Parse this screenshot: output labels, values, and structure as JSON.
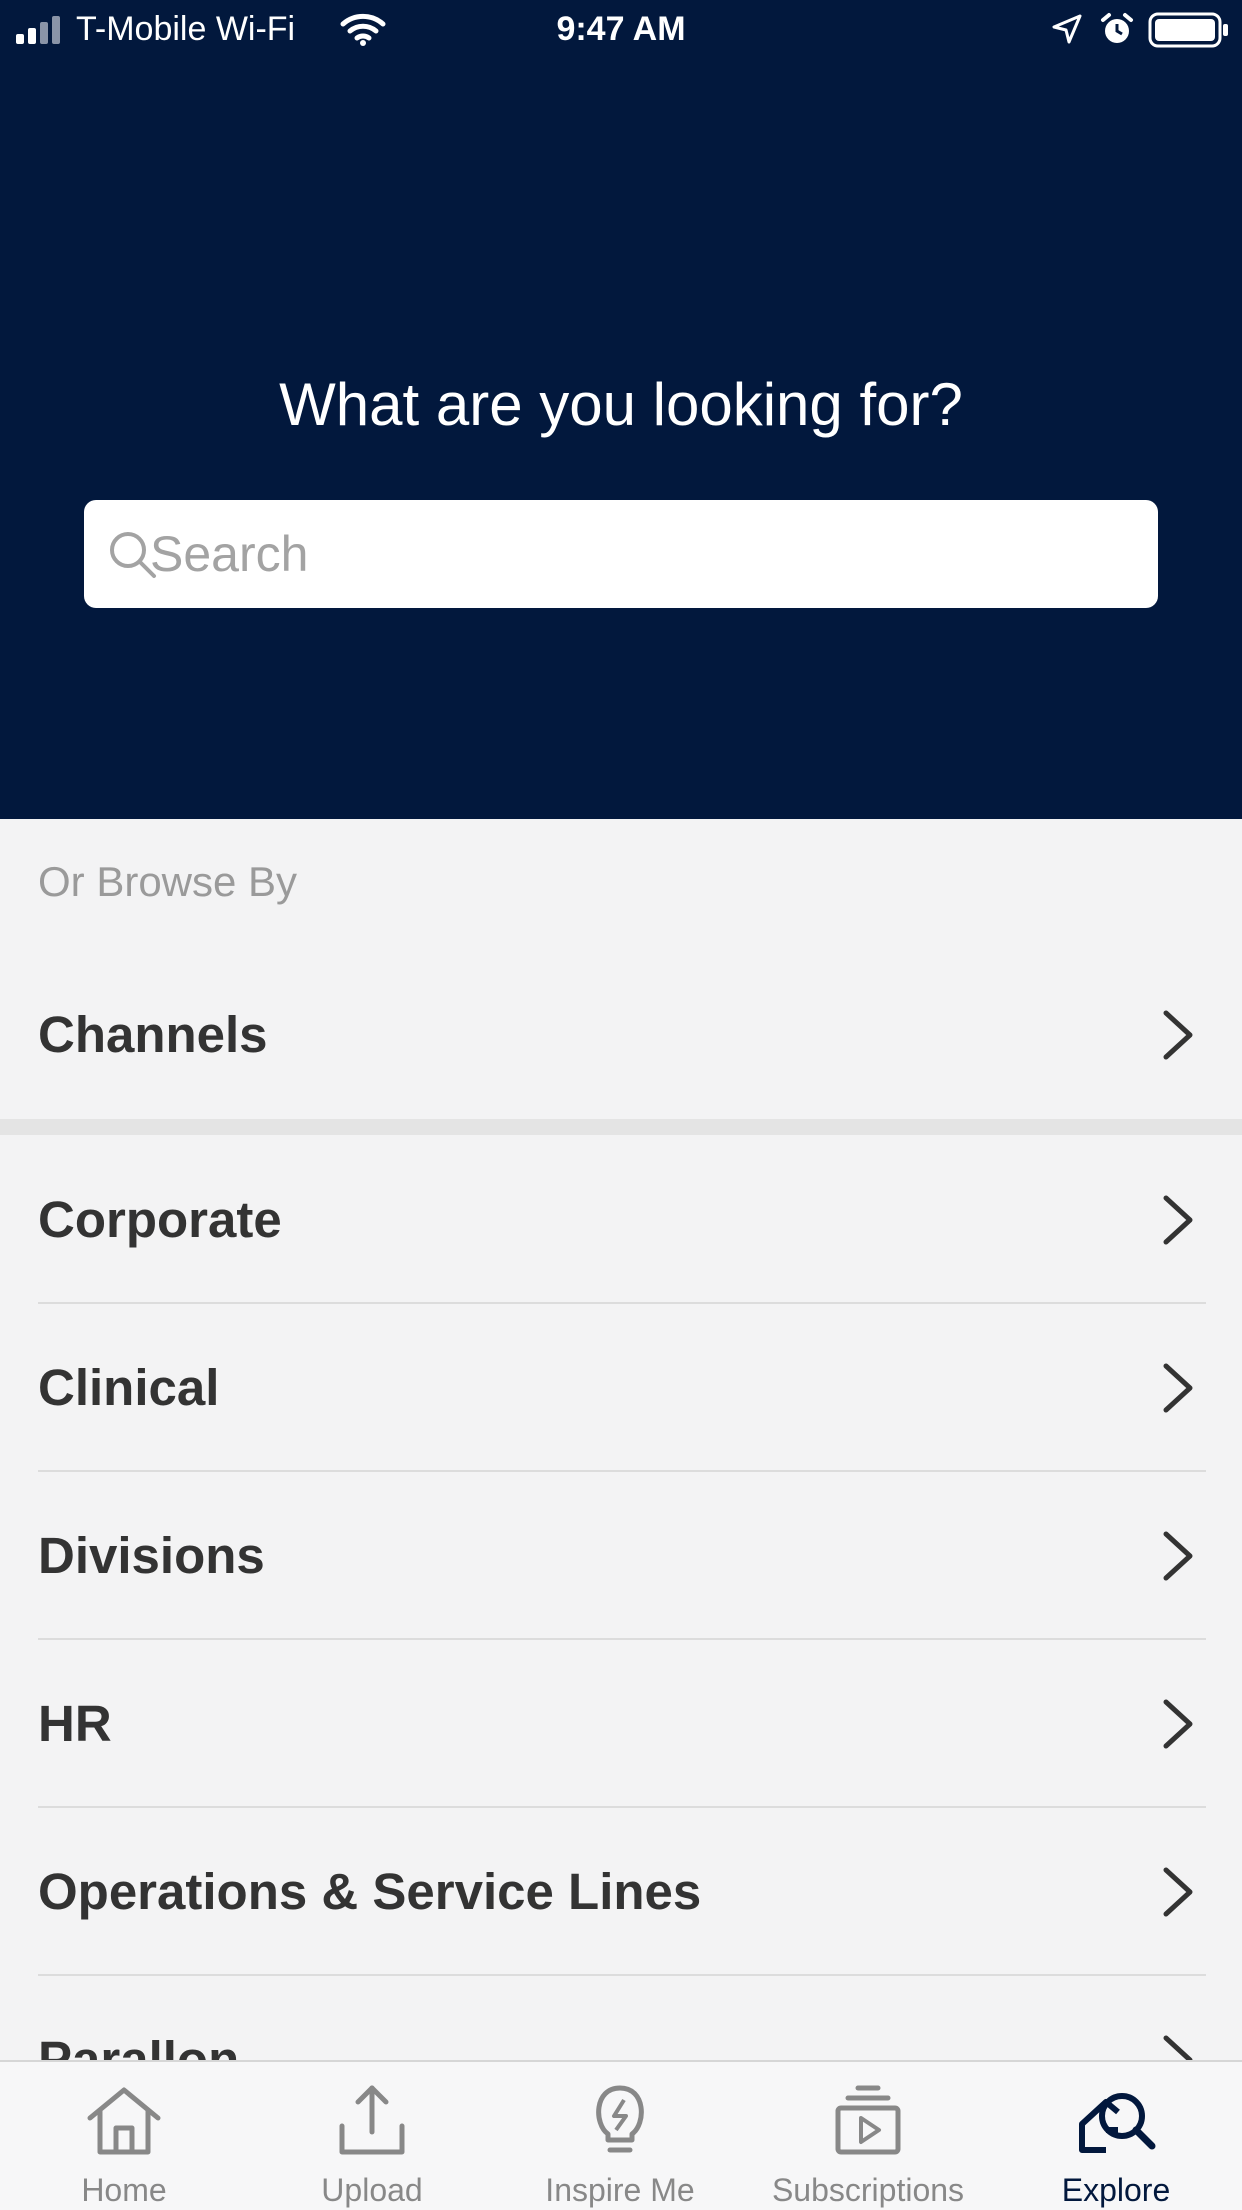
{
  "status_bar": {
    "carrier": "T-Mobile Wi-Fi",
    "time": "9:47 AM"
  },
  "hero": {
    "title": "What are you looking for?",
    "search_placeholder": "Search",
    "background_color": "#02183d"
  },
  "browse": {
    "label": "Or Browse By",
    "primary_item": {
      "label": "Channels",
      "icon": "chevron-right-icon"
    },
    "items": [
      {
        "label": "Corporate",
        "icon": "chevron-right-icon"
      },
      {
        "label": "Clinical",
        "icon": "chevron-right-icon"
      },
      {
        "label": "Divisions",
        "icon": "chevron-right-icon"
      },
      {
        "label": "HR",
        "icon": "chevron-right-icon"
      },
      {
        "label": "Operations & Service Lines",
        "icon": "chevron-right-icon"
      },
      {
        "label": "Parallon",
        "icon": "chevron-right-icon"
      }
    ]
  },
  "tab_bar": {
    "active": "Explore",
    "tabs": [
      {
        "label": "Home",
        "icon": "home-icon"
      },
      {
        "label": "Upload",
        "icon": "upload-icon"
      },
      {
        "label": "Inspire Me",
        "icon": "lightbulb-icon"
      },
      {
        "label": "Subscriptions",
        "icon": "subscriptions-icon"
      },
      {
        "label": "Explore",
        "icon": "explore-icon"
      }
    ],
    "active_color": "#02183d",
    "inactive_color": "#888888"
  }
}
